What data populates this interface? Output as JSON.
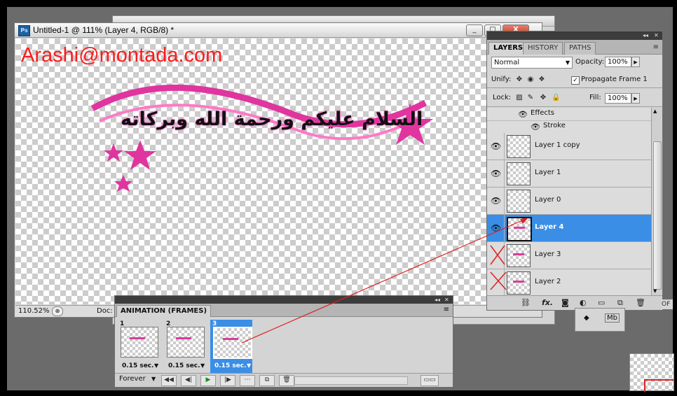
{
  "document": {
    "title": "Untitled-1 @ 111% (Layer 4, RGB/8) *",
    "app_icon": "Ps",
    "watermark": "Arashi@montada.com",
    "artwork_text": "السلام عليكم ورحمة الله وبركاته",
    "zoom": "110.52%",
    "doc_label": "Doc:",
    "buttons": {
      "minimize": "_",
      "maximize": "□",
      "close": "X"
    }
  },
  "layers_panel": {
    "collapse": "◂◂",
    "close": "✕",
    "tabs": [
      "LAYERS",
      "HISTORY",
      "PATHS"
    ],
    "menu_icon": "≡",
    "blend_mode": "Normal",
    "opacity_label": "Opacity:",
    "opacity_value": "100%",
    "unify_label": "Unify:",
    "propagate_label": "Propagate Frame 1",
    "lock_label": "Lock:",
    "fill_label": "Fill:",
    "fill_value": "100%",
    "effects_label": "Effects",
    "stroke_label": "Stroke",
    "layers": [
      {
        "name": "Layer 1 copy",
        "visible": true,
        "selected": false
      },
      {
        "name": "Layer 1",
        "visible": true,
        "selected": false
      },
      {
        "name": "Layer 0",
        "visible": true,
        "selected": false
      },
      {
        "name": "Layer 4",
        "visible": true,
        "selected": true
      },
      {
        "name": "Layer 3",
        "visible": false,
        "selected": false
      },
      {
        "name": "Layer 2",
        "visible": false,
        "selected": false
      }
    ],
    "bottom_icons": [
      "link-icon",
      "fx-icon",
      "mask-icon",
      "adjustment-icon",
      "group-icon",
      "new-layer-icon",
      "trash-icon"
    ]
  },
  "animation_panel": {
    "collapse": "◂◂",
    "close": "✕",
    "tab": "ANIMATION (FRAMES)",
    "menu_icon": "≡",
    "frames": [
      {
        "number": "1",
        "delay": "0.15 sec."
      },
      {
        "number": "2",
        "delay": "0.15 sec."
      },
      {
        "number": "3",
        "delay": "0.15 sec."
      }
    ],
    "loop": "Forever"
  },
  "side_panel": {
    "mb_label": "Mb"
  },
  "colors": {
    "selection": "#3a8ee6",
    "watermark": "#ff1a1a",
    "pink": "#e0359f",
    "annotation": "#e02020"
  }
}
